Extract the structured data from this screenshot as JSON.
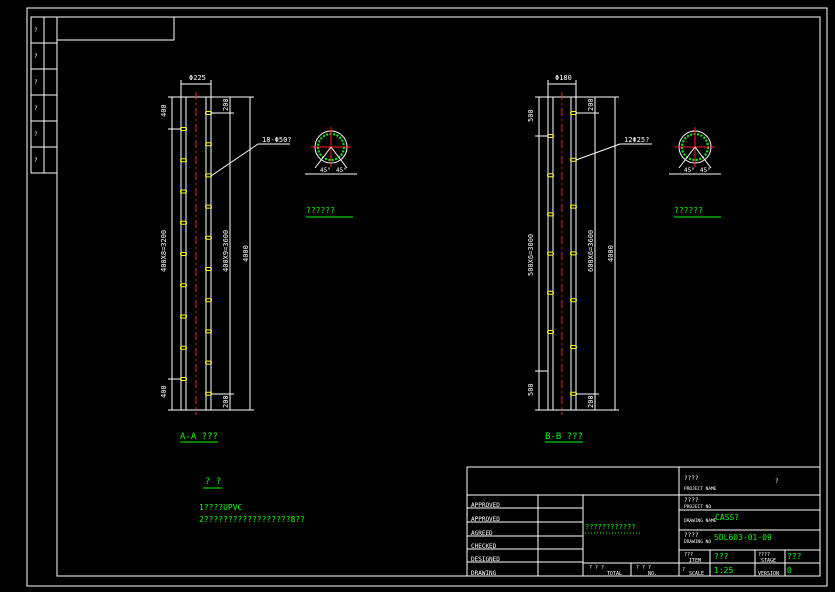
{
  "colors": {
    "background": "#000000",
    "frame": "#ffffff",
    "pipe": "#ffffff",
    "centerline": "#ff2020",
    "hole": "#ffff00",
    "label": "#00ff00",
    "underline": "#00ff00"
  },
  "left_strip": {
    "labels": [
      "?",
      "?",
      "?",
      "?",
      "?",
      "?"
    ]
  },
  "section_a": {
    "dim_width": "Φ225",
    "dim_top": "400",
    "dim_bottom": "400",
    "dim_middle": "400X8=3200",
    "dim_right_top": "200",
    "dim_right_bottom": "200",
    "dim_right_middle": "400X9=3600",
    "dim_total": "4000",
    "leader_label": "18-Φ50?",
    "view_label": "A-A ???"
  },
  "section_b": {
    "dim_width": "Φ180",
    "dim_top": "500",
    "dim_bottom": "500",
    "dim_middle": "500X6=3000",
    "dim_right_top": "200",
    "dim_right_bottom": "200",
    "dim_right_middle": "600X6=3600",
    "dim_total": "4000",
    "leader_label": "12Φ25?",
    "view_label": "B-B ???"
  },
  "circle_a": {
    "label": "??????",
    "angle_left": "45°",
    "angle_right": "45°"
  },
  "circle_b": {
    "label": "??????",
    "angle_left": "45°",
    "angle_right": "45°"
  },
  "notes": {
    "title": "? ?",
    "line1": "1????UPVC",
    "line2": "2??????????????????8??"
  },
  "title_block": {
    "project_name_cn": "????",
    "project_name_en": "PROJECT NAME",
    "project_value": "?",
    "approved_1": "APPROVED",
    "approved_2": "APPROVED",
    "agreed": "AGREED",
    "checked": "CHECKED",
    "designed": "DESIGNED",
    "drawing": "DRAWING",
    "center_text": "????????????",
    "project_no_cn": "????",
    "project_no_en": "PROJECT NO",
    "project_no_value": "CASS?",
    "drawing_no_cn": "????",
    "drawing_no_en": "DRAWING NO",
    "drawing_no_value": "SDL603-01-09",
    "drawing_name_en": "DRAWING NAME",
    "total_label": "TOTAL",
    "total_qmarks": "?  ?  ?",
    "no_label": "NO.",
    "no_qmarks": "?  ?  ?",
    "item_label": "ITEM",
    "item_cn": "???",
    "item_value": "???",
    "stage_label": "STAGE",
    "stage_cn": "????",
    "stage_value": "???",
    "scale_label": "SCALE",
    "scale_value": "1:25",
    "version_label": "VERSION",
    "version_value": "0",
    "small_q": "?"
  }
}
